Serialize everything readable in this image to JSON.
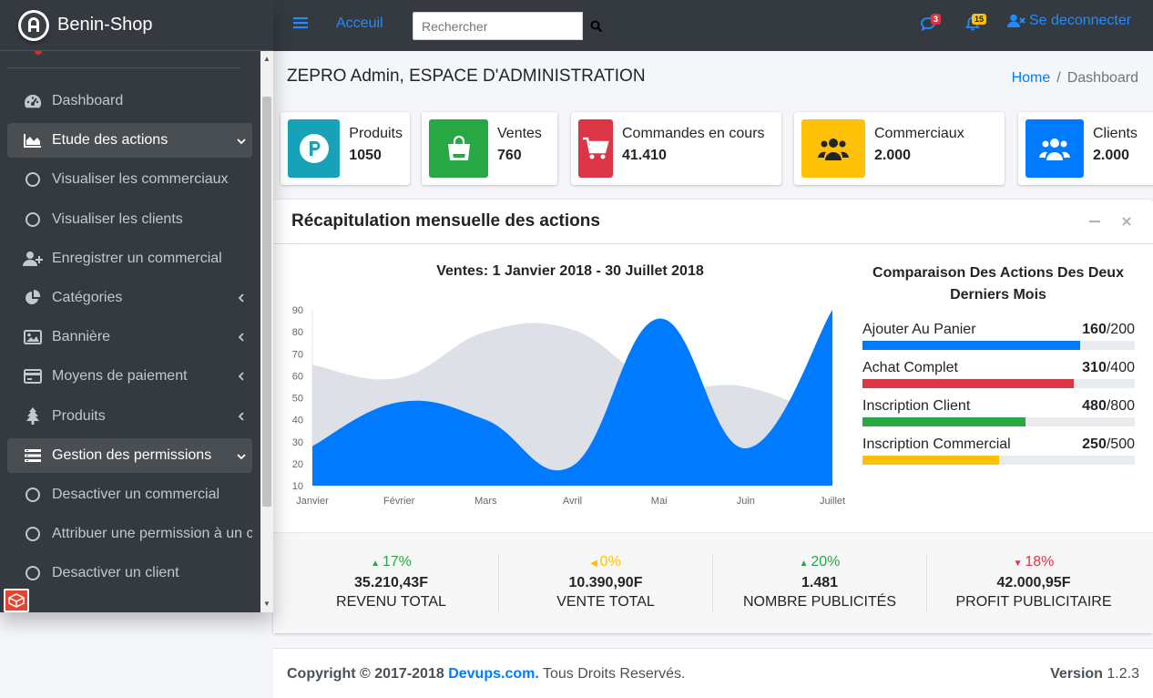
{
  "brand": {
    "name": "Benin-Shop"
  },
  "sidebar": {
    "items": [
      {
        "label": "Dashboard",
        "icon": "tachometer-icon"
      },
      {
        "label": "Etude des actions",
        "icon": "area-chart-icon"
      },
      {
        "label": "Visualiser les commerciaux",
        "icon": "circle-icon"
      },
      {
        "label": "Visualiser les clients",
        "icon": "circle-icon"
      },
      {
        "label": "Enregistrer un commercial",
        "icon": "user-plus-icon"
      },
      {
        "label": "Catégories",
        "icon": "pie-chart-icon"
      },
      {
        "label": "Bannière",
        "icon": "image-icon"
      },
      {
        "label": "Moyens de paiement",
        "icon": "credit-card-icon"
      },
      {
        "label": "Produits",
        "icon": "tree-icon"
      },
      {
        "label": "Gestion des permissions",
        "icon": "list-icon"
      },
      {
        "label": "Desactiver un commercial",
        "icon": "circle-icon"
      },
      {
        "label": "Attribuer une permission à un c",
        "icon": "circle-icon"
      },
      {
        "label": "Desactiver un client",
        "icon": "circle-icon"
      }
    ]
  },
  "topbar": {
    "home_link": "Acceuil",
    "search_placeholder": "Rechercher",
    "messages_count": "3",
    "notifications_count": "15",
    "logout": "Se deconnecter"
  },
  "header": {
    "title": "ZEPRO Admin, ESPACE D'ADMINISTRATION",
    "breadcrumb_home": "Home",
    "breadcrumb_sep": "/",
    "breadcrumb_current": "Dashboard"
  },
  "info_boxes": [
    {
      "label": "Produits",
      "value": "1050",
      "color": "#17a2b8",
      "icon": "parking-icon"
    },
    {
      "label": "Ventes",
      "value": "760",
      "color": "#28a745",
      "icon": "shopping-bag-icon"
    },
    {
      "label": "Commandes en cours",
      "value": "41.410",
      "color": "#dc3545",
      "icon": "shopping-cart-icon"
    },
    {
      "label": "Commerciaux",
      "value": "2.000",
      "color": "#ffc107",
      "icon": "users-icon"
    },
    {
      "label": "Clients",
      "value": "2.000",
      "color": "#007bff",
      "icon": "users-icon"
    }
  ],
  "card": {
    "title": "Récapitulation mensuelle des actions",
    "chart_title": "Ventes: 1 Janvier 2018 - 30 Juillet 2018",
    "comparison_title": "Comparaison Des Actions Des Deux Derniers Mois",
    "progress": [
      {
        "label": "Ajouter Au Panier",
        "value": "160",
        "total": "/200",
        "fraction": 0.8,
        "color": "#007bff"
      },
      {
        "label": "Achat Complet",
        "value": "310",
        "total": "/400",
        "fraction": 0.775,
        "color": "#dc3545"
      },
      {
        "label": "Inscription Client",
        "value": "480",
        "total": "/800",
        "fraction": 0.6,
        "color": "#28a745"
      },
      {
        "label": "Inscription Commercial",
        "value": "250",
        "total": "/500",
        "fraction": 0.5,
        "color": "#ffc107"
      }
    ],
    "stats": [
      {
        "pct": "17%",
        "dir": "up",
        "color": "#28a745",
        "value": "35.210,43F",
        "label": "Revenu Total"
      },
      {
        "pct": "0%",
        "dir": "left",
        "color": "#ffc107",
        "value": "10.390,90F",
        "label": "Vente Total"
      },
      {
        "pct": "20%",
        "dir": "up",
        "color": "#28a745",
        "value": "1.481",
        "label": "Nombre Publicités"
      },
      {
        "pct": "18%",
        "dir": "down",
        "color": "#dc3545",
        "value": "42.000,95F",
        "label": "Profit Publicitaire"
      }
    ]
  },
  "chart_data": {
    "type": "area",
    "title": "Ventes: 1 Janvier 2018 - 30 Juillet 2018",
    "categories": [
      "Janvier",
      "Février",
      "Mars",
      "Avril",
      "Mai",
      "Juin",
      "Juillet"
    ],
    "ylim": [
      10,
      90
    ],
    "yticks": [
      10,
      20,
      30,
      40,
      50,
      60,
      70,
      80,
      90
    ],
    "series": [
      {
        "color": "#d2d6de",
        "values": [
          65,
          59,
          80,
          81,
          56,
          55,
          40
        ]
      },
      {
        "color": "#007bff",
        "values": [
          28,
          48,
          40,
          19,
          86,
          27,
          90
        ]
      }
    ]
  },
  "footer": {
    "copyright": "Copyright © 2017-2018",
    "company": "Devups.com.",
    "rights": "Tous Droits Reservés.",
    "version_label": "Version",
    "version": "1.2.3"
  }
}
